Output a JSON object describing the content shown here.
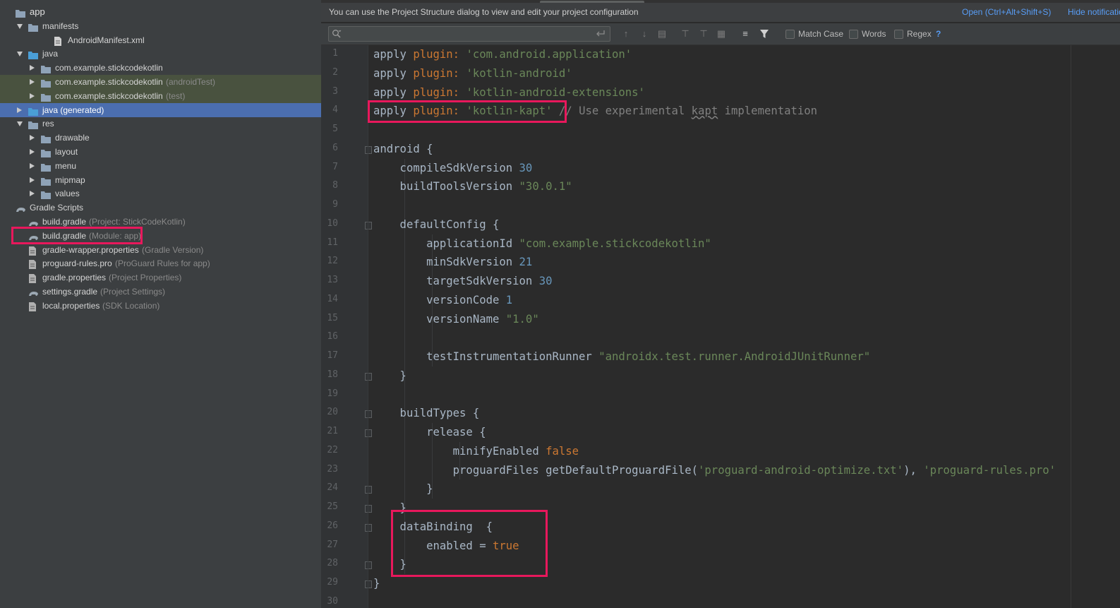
{
  "project_tree": {
    "items": [
      {
        "label": "app",
        "hint": "",
        "indent": 0,
        "arrow": "none",
        "icon": "module-folder-icon"
      },
      {
        "label": "manifests",
        "hint": "",
        "indent": 1,
        "arrow": "down",
        "icon": "folder-icon"
      },
      {
        "label": "AndroidManifest.xml",
        "hint": "",
        "indent": 3,
        "arrow": "none",
        "icon": "manifest-file-icon"
      },
      {
        "label": "java",
        "hint": "",
        "indent": 1,
        "arrow": "down",
        "icon": "source-folder-icon"
      },
      {
        "label": "com.example.stickcodekotlin",
        "hint": "",
        "indent": 2,
        "arrow": "right",
        "icon": "package-icon"
      },
      {
        "label": "com.example.stickcodekotlin",
        "hint": "(androidTest)",
        "indent": 2,
        "arrow": "right",
        "icon": "package-icon"
      },
      {
        "label": "com.example.stickcodekotlin",
        "hint": "(test)",
        "indent": 2,
        "arrow": "right",
        "icon": "package-icon"
      },
      {
        "label": "java (generated)",
        "hint": "",
        "indent": 1,
        "arrow": "right",
        "icon": "generated-folder-icon"
      },
      {
        "label": "res",
        "hint": "",
        "indent": 1,
        "arrow": "down",
        "icon": "resource-folder-icon"
      },
      {
        "label": "drawable",
        "hint": "",
        "indent": 2,
        "arrow": "right",
        "icon": "folder-icon"
      },
      {
        "label": "layout",
        "hint": "",
        "indent": 2,
        "arrow": "right",
        "icon": "folder-icon"
      },
      {
        "label": "menu",
        "hint": "",
        "indent": 2,
        "arrow": "right",
        "icon": "folder-icon"
      },
      {
        "label": "mipmap",
        "hint": "",
        "indent": 2,
        "arrow": "right",
        "icon": "folder-icon"
      },
      {
        "label": "values",
        "hint": "",
        "indent": 2,
        "arrow": "right",
        "icon": "folder-icon"
      },
      {
        "label": "Gradle Scripts",
        "hint": "",
        "indent": 0,
        "arrow": "none",
        "icon": "gradle-icon"
      },
      {
        "label": "build.gradle",
        "hint": "(Project: StickCodeKotlin)",
        "indent": 1,
        "arrow": "none",
        "icon": "gradle-icon"
      },
      {
        "label": "build.gradle",
        "hint": "(Module: app)",
        "indent": 1,
        "arrow": "none",
        "icon": "gradle-icon"
      },
      {
        "label": "gradle-wrapper.properties",
        "hint": "(Gradle Version)",
        "indent": 1,
        "arrow": "none",
        "icon": "properties-file-icon"
      },
      {
        "label": "proguard-rules.pro",
        "hint": "(ProGuard Rules for app)",
        "indent": 1,
        "arrow": "none",
        "icon": "text-file-icon"
      },
      {
        "label": "gradle.properties",
        "hint": "(Project Properties)",
        "indent": 1,
        "arrow": "none",
        "icon": "properties-file-icon"
      },
      {
        "label": "settings.gradle",
        "hint": "(Project Settings)",
        "indent": 1,
        "arrow": "none",
        "icon": "gradle-icon"
      },
      {
        "label": "local.properties",
        "hint": "(SDK Location)",
        "indent": 1,
        "arrow": "none",
        "icon": "properties-file-icon"
      }
    ],
    "selected_label": "java (generated)",
    "highlighted_label": "build.gradle (Module: app)"
  },
  "notification": {
    "text": "You can use the Project Structure dialog to view and edit your project configuration",
    "open_link": "Open (Ctrl+Alt+Shift+S)",
    "hide_link": "Hide notification"
  },
  "find_bar": {
    "search_value": "",
    "options": [
      {
        "label": "Match Case",
        "checked": false
      },
      {
        "label": "Words",
        "checked": false
      },
      {
        "label": "Regex",
        "checked": false
      }
    ],
    "help": "?"
  },
  "editor": {
    "line_numbers": [
      "1",
      "2",
      "3",
      "4",
      "5",
      "6",
      "7",
      "8",
      "9",
      "10",
      "11",
      "12",
      "13",
      "14",
      "15",
      "16",
      "17",
      "18",
      "19",
      "20",
      "21",
      "22",
      "23",
      "24",
      "25",
      "26",
      "27",
      "28",
      "29",
      "30"
    ],
    "lines": [
      [
        {
          "t": "apply ",
          "c": ""
        },
        {
          "t": "plugin: ",
          "c": "k"
        },
        {
          "t": "'com.android.application'",
          "c": "s"
        }
      ],
      [
        {
          "t": "apply ",
          "c": ""
        },
        {
          "t": "plugin: ",
          "c": "k"
        },
        {
          "t": "'kotlin-android'",
          "c": "s"
        }
      ],
      [
        {
          "t": "apply ",
          "c": ""
        },
        {
          "t": "plugin: ",
          "c": "k"
        },
        {
          "t": "'kotlin-android-extensions'",
          "c": "s"
        }
      ],
      [
        {
          "t": "apply ",
          "c": ""
        },
        {
          "t": "plugin: ",
          "c": "k"
        },
        {
          "t": "'kotlin-kapt'",
          "c": "s"
        },
        {
          "t": " // Use experimental ",
          "c": "c"
        },
        {
          "t": "kapt",
          "c": "c u"
        },
        {
          "t": " implementation",
          "c": "c"
        }
      ],
      [],
      [
        {
          "t": "android {",
          "c": ""
        }
      ],
      [
        {
          "t": "    compileSdkVersion ",
          "c": ""
        },
        {
          "t": "30",
          "c": "n"
        }
      ],
      [
        {
          "t": "    buildToolsVersion ",
          "c": ""
        },
        {
          "t": "\"30.0.1\"",
          "c": "s"
        }
      ],
      [],
      [
        {
          "t": "    defaultConfig {",
          "c": ""
        }
      ],
      [
        {
          "t": "        applicationId ",
          "c": ""
        },
        {
          "t": "\"com.example.stickcodekotlin\"",
          "c": "s"
        }
      ],
      [
        {
          "t": "        minSdkVersion ",
          "c": ""
        },
        {
          "t": "21",
          "c": "n"
        }
      ],
      [
        {
          "t": "        targetSdkVersion ",
          "c": ""
        },
        {
          "t": "30",
          "c": "n"
        }
      ],
      [
        {
          "t": "        versionCode ",
          "c": ""
        },
        {
          "t": "1",
          "c": "n"
        }
      ],
      [
        {
          "t": "        versionName ",
          "c": ""
        },
        {
          "t": "\"1.0\"",
          "c": "s"
        }
      ],
      [],
      [
        {
          "t": "        testInstrumentationRunner ",
          "c": ""
        },
        {
          "t": "\"androidx.test.runner.AndroidJUnitRunner\"",
          "c": "s"
        }
      ],
      [
        {
          "t": "    }",
          "c": ""
        }
      ],
      [],
      [
        {
          "t": "    buildTypes {",
          "c": ""
        }
      ],
      [
        {
          "t": "        release {",
          "c": ""
        }
      ],
      [
        {
          "t": "            minifyEnabled ",
          "c": ""
        },
        {
          "t": "false",
          "c": "k"
        }
      ],
      [
        {
          "t": "            proguardFiles getDefaultProguardFile(",
          "c": ""
        },
        {
          "t": "'proguard-android-optimize.txt'",
          "c": "s"
        },
        {
          "t": "), ",
          "c": ""
        },
        {
          "t": "'proguard-rules.pro'",
          "c": "s"
        }
      ],
      [
        {
          "t": "        }",
          "c": ""
        }
      ],
      [
        {
          "t": "    }",
          "c": ""
        }
      ],
      [
        {
          "t": "    dataBinding  {",
          "c": ""
        }
      ],
      [
        {
          "t": "        enabled = ",
          "c": ""
        },
        {
          "t": "true",
          "c": "k"
        }
      ],
      [
        {
          "t": "    }",
          "c": ""
        }
      ],
      [
        {
          "t": "}",
          "c": ""
        }
      ],
      []
    ],
    "fold_marker_lines": [
      6,
      10,
      18,
      20,
      21,
      24,
      25,
      26,
      28,
      29
    ]
  },
  "colors": {
    "highlight_box": "#e8185c",
    "keyword": "#cc7832",
    "string": "#6a8759",
    "number": "#6897bb",
    "comment": "#808080",
    "selection": "#4b6eaf",
    "link": "#589df6"
  }
}
